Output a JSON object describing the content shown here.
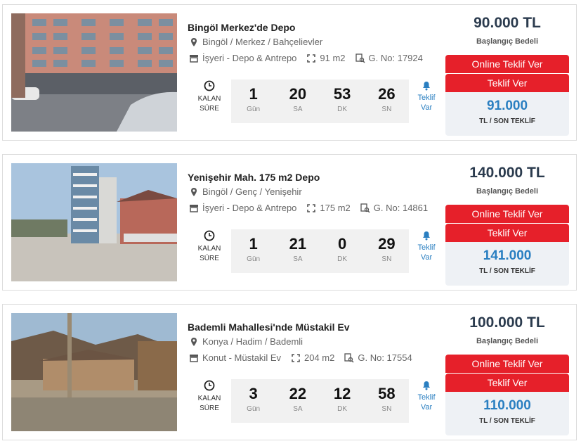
{
  "listings": [
    {
      "title": "Bingöl Merkez'de Depo",
      "location": "Bingöl / Merkez / Bahçelievler",
      "category": "İşyeri - Depo & Antrepo",
      "area": "91 m2",
      "gno": "G. No: 17924",
      "countdown_label_1": "KALAN",
      "countdown_label_2": "SÜRE",
      "timer": [
        {
          "value": "1",
          "unit": "Gün"
        },
        {
          "value": "20",
          "unit": "SA"
        },
        {
          "value": "53",
          "unit": "DK"
        },
        {
          "value": "26",
          "unit": "SN"
        }
      ],
      "bid_notice_1": "Teklif",
      "bid_notice_2": "Var",
      "start_price": "90.000 TL",
      "start_label": "Başlangıç Bedeli",
      "online_bid_label": "Online Teklif Ver",
      "bid_label": "Teklif Ver",
      "last_bid": "91.000",
      "last_bid_label": "TL / SON TEKLİF"
    },
    {
      "title": "Yenişehir Mah. 175 m2 Depo",
      "location": "Bingöl / Genç / Yenişehir",
      "category": "İşyeri - Depo & Antrepo",
      "area": "175 m2",
      "gno": "G. No: 14861",
      "countdown_label_1": "KALAN",
      "countdown_label_2": "SÜRE",
      "timer": [
        {
          "value": "1",
          "unit": "Gün"
        },
        {
          "value": "21",
          "unit": "SA"
        },
        {
          "value": "0",
          "unit": "DK"
        },
        {
          "value": "29",
          "unit": "SN"
        }
      ],
      "bid_notice_1": "Teklif",
      "bid_notice_2": "Var",
      "start_price": "140.000 TL",
      "start_label": "Başlangıç Bedeli",
      "online_bid_label": "Online Teklif Ver",
      "bid_label": "Teklif Ver",
      "last_bid": "141.000",
      "last_bid_label": "TL / SON TEKLİF"
    },
    {
      "title": "Bademli Mahallesi'nde Müstakil Ev",
      "location": "Konya / Hadim / Bademli",
      "category": "Konut - Müstakil Ev",
      "area": "204 m2",
      "gno": "G. No: 17554",
      "countdown_label_1": "KALAN",
      "countdown_label_2": "SÜRE",
      "timer": [
        {
          "value": "3",
          "unit": "Gün"
        },
        {
          "value": "22",
          "unit": "SA"
        },
        {
          "value": "12",
          "unit": "DK"
        },
        {
          "value": "58",
          "unit": "SN"
        }
      ],
      "bid_notice_1": "Teklif",
      "bid_notice_2": "Var",
      "start_price": "100.000 TL",
      "start_label": "Başlangıç Bedeli",
      "online_bid_label": "Online Teklif Ver",
      "bid_label": "Teklif Ver",
      "last_bid": "110.000",
      "last_bid_label": "TL / SON TEKLİF"
    }
  ],
  "icons": {
    "location": "map-pin-icon",
    "category": "shop-icon",
    "area": "resize-icon",
    "gno": "search-doc-icon",
    "countdown": "clock-icon",
    "bid_notice": "bell-icon"
  },
  "colors": {
    "accent_red": "#e6202a",
    "accent_blue": "#2a7fc1",
    "price_dark": "#2b3b4e"
  }
}
